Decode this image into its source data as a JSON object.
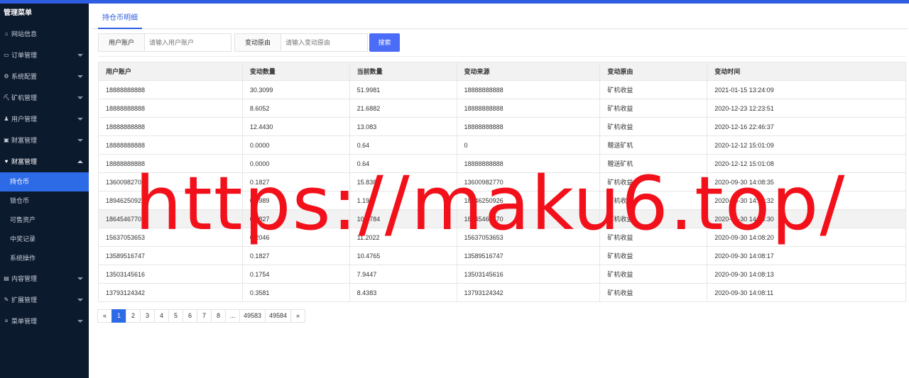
{
  "sidebar": {
    "title": "管理菜单",
    "items": [
      {
        "icon": "home-icon",
        "glyph": "⌂",
        "label": "网站信息",
        "arrow": false
      },
      {
        "icon": "order-icon",
        "glyph": "▭",
        "label": "订单管理",
        "arrow": true
      },
      {
        "icon": "gears-icon",
        "glyph": "⚙",
        "label": "系统配置",
        "arrow": true
      },
      {
        "icon": "miner-icon",
        "glyph": "⛏",
        "label": "矿机管理",
        "arrow": true
      },
      {
        "icon": "users-icon",
        "glyph": "♟",
        "label": "用户管理",
        "arrow": true
      },
      {
        "icon": "wallet-icon",
        "glyph": "▣",
        "label": "财富管理",
        "arrow": true
      }
    ],
    "open_group": {
      "icon": "heart-icon",
      "glyph": "♥",
      "label": "财富管理"
    },
    "subitems": [
      "持仓币",
      "锁仓币",
      "可售资产",
      "中奖记录",
      "系统操作"
    ],
    "items_after": [
      {
        "icon": "file-icon",
        "glyph": "▤",
        "label": "内容管理"
      },
      {
        "icon": "wrench-icon",
        "glyph": "✎",
        "label": "扩展管理"
      },
      {
        "icon": "menu-icon",
        "glyph": "≡",
        "label": "菜单管理"
      }
    ]
  },
  "tab": {
    "label": "持仓币明细"
  },
  "search": {
    "account_label": "用户账户",
    "account_placeholder": "请输入用户账户",
    "reason_label": "变动原由",
    "reason_placeholder": "请输入变动原由",
    "button": "搜索"
  },
  "table": {
    "columns": [
      "用户账户",
      "变动数量",
      "当前数量",
      "变动来源",
      "变动原由",
      "变动时间"
    ],
    "rows": [
      [
        "18888888888",
        "30.3099",
        "51.9981",
        "18888888888",
        "矿机收益",
        "2021-01-15 13:24:09"
      ],
      [
        "18888888888",
        "8.6052",
        "21.6882",
        "18888888888",
        "矿机收益",
        "2020-12-23 12:23:51"
      ],
      [
        "18888888888",
        "12.4430",
        "13.083",
        "18888888888",
        "矿机收益",
        "2020-12-16 22:46:37"
      ],
      [
        "18888888888",
        "0.0000",
        "0.64",
        "0",
        "赠送矿机",
        "2020-12-12 15:01:09"
      ],
      [
        "18888888888",
        "0.0000",
        "0.64",
        "18888888888",
        "赠送矿机",
        "2020-12-12 15:01:08"
      ],
      [
        "1360098270",
        "0.1827",
        "15.838",
        "13600982770",
        "矿机收益",
        "2020-09-30 14:08:35"
      ],
      [
        "1894625092",
        "0.0989",
        "1.194",
        "18946250926",
        "矿机收益",
        "2020-09-30 14:08:32"
      ],
      [
        "1864546770",
        "0.1827",
        "10.3784",
        "18645467770",
        "矿机收益",
        "2020-09-30 14:08:30"
      ],
      [
        "15637053653",
        "0.2046",
        "11.2022",
        "15637053653",
        "矿机收益",
        "2020-09-30 14:08:20"
      ],
      [
        "13589516747",
        "0.1827",
        "10.4765",
        "13589516747",
        "矿机收益",
        "2020-09-30 14:08:17"
      ],
      [
        "13503145616",
        "0.1754",
        "7.9447",
        "13503145616",
        "矿机收益",
        "2020-09-30 14:08:13"
      ],
      [
        "13793124342",
        "0.3581",
        "8.4383",
        "13793124342",
        "矿机收益",
        "2020-09-30 14:08:11"
      ]
    ],
    "highlighted_row": 7
  },
  "pagination": {
    "pages": [
      "«",
      "1",
      "2",
      "3",
      "4",
      "5",
      "6",
      "7",
      "8",
      "...",
      "49583",
      "49584",
      "»"
    ],
    "current": "1"
  },
  "watermark": "https://maku6.top/",
  "colors": {
    "sidebar_bg": "#0c1a2e",
    "accent": "#2d6ae6",
    "button": "#4a6cf7",
    "watermark": "#f2101a"
  }
}
